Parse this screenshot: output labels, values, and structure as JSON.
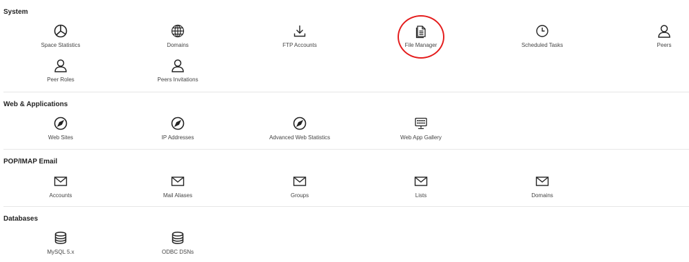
{
  "sections": {
    "system": {
      "title": "System",
      "items": {
        "space_statistics": "Space Statistics",
        "domains": "Domains",
        "ftp_accounts": "FTP Accounts",
        "file_manager": "File Manager",
        "scheduled_tasks": "Scheduled Tasks",
        "peers": "Peers",
        "peer_roles": "Peer Roles",
        "peers_invitations": "Peers Invitations"
      }
    },
    "web": {
      "title": "Web & Applications",
      "items": {
        "web_sites": "Web Sites",
        "ip_addresses": "IP Addresses",
        "advanced_web_statistics": "Advanced Web Statistics",
        "web_app_gallery": "Web App Gallery"
      }
    },
    "email": {
      "title": "POP/IMAP Email",
      "items": {
        "accounts": "Accounts",
        "mail_aliases": "Mail Aliases",
        "groups": "Groups",
        "lists": "Lists",
        "domains": "Domains"
      }
    },
    "databases": {
      "title": "Databases",
      "items": {
        "mysql": "MySQL 5.x",
        "odbc": "ODBC DSNs"
      }
    }
  },
  "icons": {
    "space_statistics": "pie-chart-icon",
    "domains": "globe-icon",
    "ftp_accounts": "download-icon",
    "file_manager": "document-icon",
    "scheduled_tasks": "clock-icon",
    "peers": "user-icon",
    "web": "compass-icon",
    "web_app_gallery": "monitor-icon",
    "email": "envelope-icon",
    "databases": "database-icon"
  },
  "annotation": {
    "highlight_color": "#e41c1c"
  }
}
